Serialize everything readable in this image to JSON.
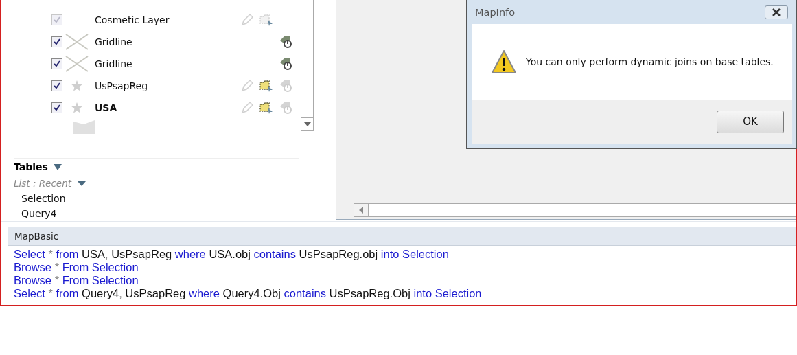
{
  "layers": [
    {
      "name": "Cosmetic Layer",
      "checked": true,
      "disabled": true,
      "kind": "plain",
      "active": false,
      "tools": [
        {
          "kind": "edit",
          "enabled": false
        },
        {
          "kind": "select",
          "enabled": false
        }
      ]
    },
    {
      "name": "Gridline",
      "checked": true,
      "disabled": false,
      "kind": "grid",
      "active": false,
      "tools": [
        {
          "kind": "label",
          "enabled": true
        }
      ]
    },
    {
      "name": "Gridline",
      "checked": true,
      "disabled": false,
      "kind": "grid",
      "active": false,
      "tools": [
        {
          "kind": "label",
          "enabled": true
        }
      ]
    },
    {
      "name": "UsPsapReg",
      "checked": true,
      "disabled": false,
      "kind": "point",
      "active": false,
      "tools": [
        {
          "kind": "edit",
          "enabled": false
        },
        {
          "kind": "select",
          "enabled": true
        },
        {
          "kind": "label",
          "enabled": false
        }
      ]
    },
    {
      "name": "USA",
      "checked": true,
      "disabled": false,
      "kind": "point",
      "active": true,
      "tools": [
        {
          "kind": "edit",
          "enabled": false
        },
        {
          "kind": "select",
          "enabled": true
        },
        {
          "kind": "label",
          "enabled": false
        }
      ]
    }
  ],
  "tables": {
    "title": "Tables",
    "list_mode": "List : Recent",
    "items": [
      "Selection",
      "Query4"
    ]
  },
  "mapbasic": {
    "title": "MapBasic",
    "lines": [
      [
        {
          "text": "Select",
          "kind": "keyword"
        },
        {
          "text": "*",
          "kind": "op"
        },
        {
          "text": "from",
          "kind": "keyword"
        },
        {
          "text": "USA",
          "kind": "name"
        },
        {
          "text": ",",
          "kind": "punct"
        },
        {
          "text": "UsPsapReg",
          "kind": "name"
        },
        {
          "text": "where",
          "kind": "keyword"
        },
        {
          "text": "USA.obj",
          "kind": "name"
        },
        {
          "text": "contains",
          "kind": "keyword"
        },
        {
          "text": "UsPsapReg.obj",
          "kind": "name"
        },
        {
          "text": "into Selection",
          "kind": "keyword"
        }
      ],
      [
        {
          "text": "Browse",
          "kind": "keyword"
        },
        {
          "text": "*",
          "kind": "op"
        },
        {
          "text": "From Selection",
          "kind": "keyword"
        }
      ],
      [
        {
          "text": "Browse",
          "kind": "keyword"
        },
        {
          "text": "*",
          "kind": "op"
        },
        {
          "text": "From Selection",
          "kind": "keyword"
        }
      ],
      [
        {
          "text": "Select",
          "kind": "keyword"
        },
        {
          "text": "*",
          "kind": "op"
        },
        {
          "text": "from",
          "kind": "keyword"
        },
        {
          "text": "Query4",
          "kind": "name"
        },
        {
          "text": ",",
          "kind": "punct"
        },
        {
          "text": "UsPsapReg",
          "kind": "name"
        },
        {
          "text": "where",
          "kind": "keyword"
        },
        {
          "text": "Query4.Obj",
          "kind": "name"
        },
        {
          "text": "contains",
          "kind": "keyword"
        },
        {
          "text": "UsPsapReg.Obj",
          "kind": "name"
        },
        {
          "text": "into Selection",
          "kind": "keyword"
        }
      ]
    ]
  },
  "dialog": {
    "title": "MapInfo",
    "message": "You can only perform dynamic joins on base tables.",
    "buttons": [
      "OK"
    ]
  }
}
